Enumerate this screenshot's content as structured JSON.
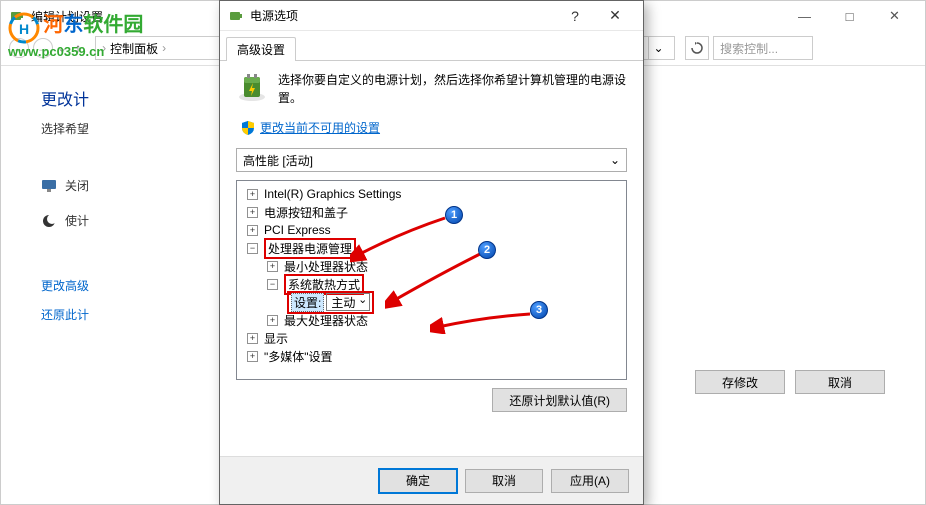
{
  "bg_window": {
    "title": "编辑计划设置",
    "breadcrumb": {
      "item1": "控制面板",
      "sep": "›"
    },
    "search": {
      "placeholder": "搜索控制..."
    },
    "heading": "更改计",
    "subtext": "选择希望",
    "item_close": "关闭",
    "item_use": "使计",
    "link_advanced": "更改高级",
    "link_restore": "还原此计",
    "btn_save": "存修改",
    "btn_cancel": "取消"
  },
  "watermark": {
    "text": "河东软件园",
    "url": "www.pc0359.cn"
  },
  "dialog": {
    "title": "电源选项",
    "tab": "高级设置",
    "description": "选择你要自定义的电源计划，然后选择你希望计算机管理的电源设置。",
    "change_unavailable": "更改当前不可用的设置",
    "plan": "高性能 [活动]",
    "tree": {
      "intel": "Intel(R) Graphics Settings",
      "power_button": "电源按钮和盖子",
      "pci": "PCI Express",
      "cpu_power": "处理器电源管理",
      "min_cpu": "最小处理器状态",
      "cooling": "系统散热方式",
      "setting_label": "设置:",
      "setting_value": "主动",
      "max_cpu": "最大处理器状态",
      "display": "显示",
      "multimedia": "\"多媒体\"设置"
    },
    "restore_defaults": "还原计划默认值(R)",
    "ok": "确定",
    "cancel": "取消",
    "apply": "应用(A)"
  },
  "badges": {
    "b1": "1",
    "b2": "2",
    "b3": "3"
  }
}
